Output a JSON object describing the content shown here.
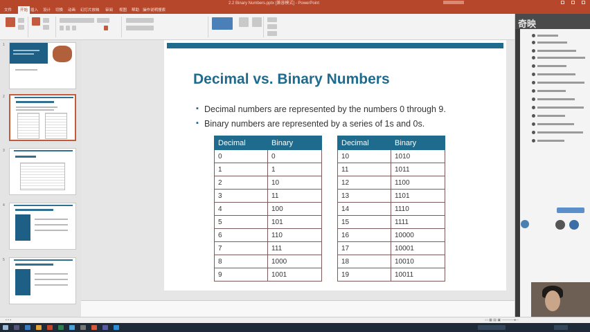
{
  "window": {
    "document_title": "2.2 Binary Numbers.pptx [兼容模式] - PowerPoint",
    "brand_color": "#b7472a"
  },
  "ribbon": {
    "tabs": [
      "文件",
      "开始",
      "插入",
      "设计",
      "切换",
      "动画",
      "幻灯片放映",
      "审阅",
      "视图",
      "帮助",
      "操作说明搜索"
    ],
    "active_tab_index": 1
  },
  "thumbnails": {
    "numbers": [
      "1",
      "2",
      "3",
      "4",
      "5"
    ],
    "selected_index": 1
  },
  "slide": {
    "title": "Decimal vs. Binary Numbers",
    "bullets": [
      "Decimal numbers are represented by the numbers 0 through 9.",
      "Binary numbers are represented by a series of 1s and 0s."
    ],
    "accent_color": "#1f6b8e",
    "table_headers": [
      "Decimal",
      "Binary"
    ],
    "left_table": [
      [
        "0",
        "0"
      ],
      [
        "1",
        "1"
      ],
      [
        "2",
        "10"
      ],
      [
        "3",
        "11"
      ],
      [
        "4",
        "100"
      ],
      [
        "5",
        "101"
      ],
      [
        "6",
        "110"
      ],
      [
        "7",
        "111"
      ],
      [
        "8",
        "1000"
      ],
      [
        "9",
        "1001"
      ]
    ],
    "right_table": [
      [
        "10",
        "1010"
      ],
      [
        "11",
        "1011"
      ],
      [
        "12",
        "1100"
      ],
      [
        "13",
        "1101"
      ],
      [
        "14",
        "1110"
      ],
      [
        "15",
        "1111"
      ],
      [
        "16",
        "10000"
      ],
      [
        "17",
        "10001"
      ],
      [
        "18",
        "10010"
      ],
      [
        "19",
        "10011"
      ]
    ]
  },
  "chat": {
    "header": "奇映"
  }
}
